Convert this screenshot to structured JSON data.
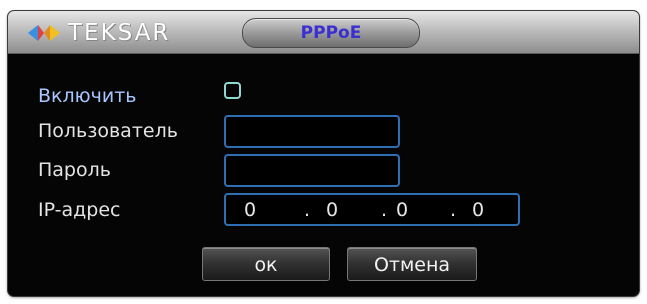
{
  "titlebar": {
    "logo_text": "TEKSAR",
    "logo_icon": "teksar-logo-icon",
    "title": "PPPoE"
  },
  "form": {
    "enable_label": "Включить",
    "enable_checked": false,
    "user_label": "Пользователь",
    "user_value": "",
    "password_label": "Пароль",
    "password_value": "",
    "ip_label": "IP-адрес",
    "ip": [
      "0",
      "0",
      "0",
      "0"
    ],
    "ip_separator": "."
  },
  "buttons": {
    "ok_label": "ок",
    "cancel_label": "Отмена"
  },
  "colors": {
    "title_text": "#3b2fcf",
    "enable_label": "#a9c6ff",
    "field_border": "#2e6fb3",
    "checkbox_border": "#8fd7cf"
  }
}
